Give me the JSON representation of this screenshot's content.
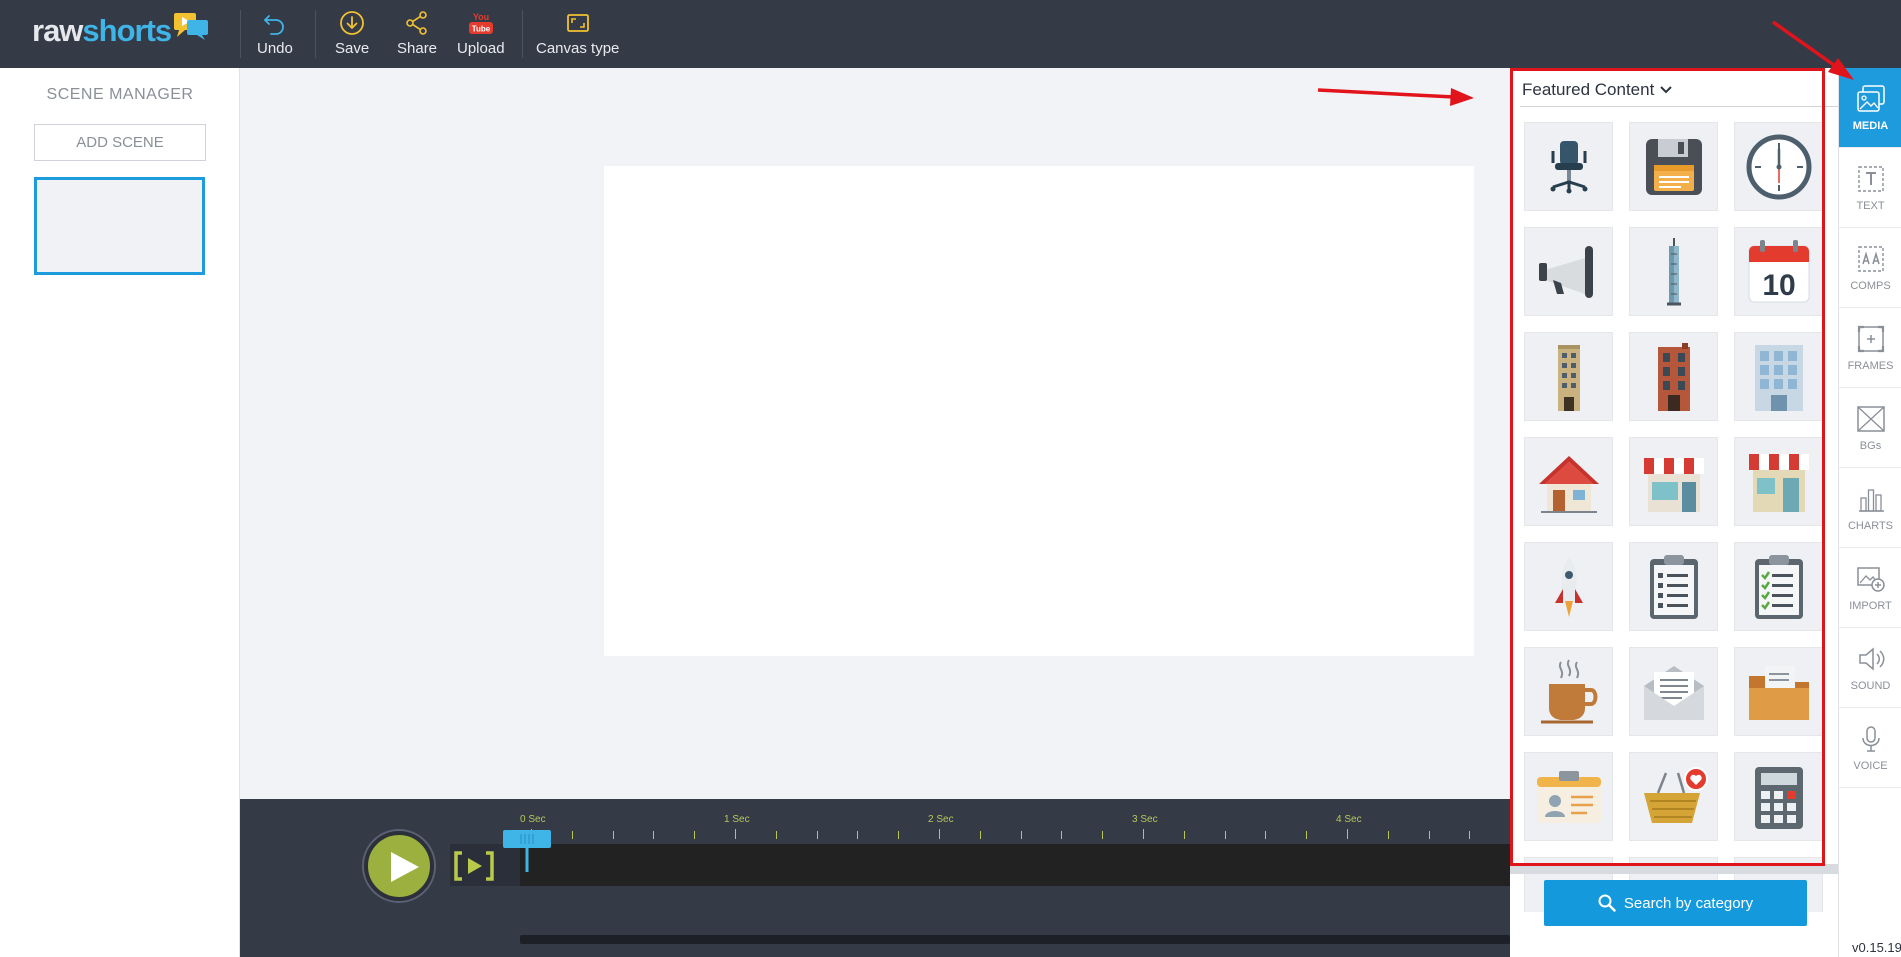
{
  "app": {
    "logo_part1": "raw",
    "logo_part2": "shorts"
  },
  "toolbar": {
    "undo": "Undo",
    "save": "Save",
    "share": "Share",
    "upload": "Upload",
    "youtube_badge_top": "You",
    "youtube_badge_bottom": "Tube",
    "canvas_type": "Canvas type"
  },
  "scene_manager": {
    "title": "SCENE MANAGER",
    "add_scene": "ADD SCENE"
  },
  "timeline": {
    "labels": [
      "0 Sec",
      "1 Sec",
      "2 Sec",
      "3 Sec",
      "4 Sec"
    ]
  },
  "media_panel": {
    "heading": "Featured Content",
    "search_button": "Search by category",
    "items": [
      {
        "icon": "office-chair-icon"
      },
      {
        "icon": "floppy-disk-icon"
      },
      {
        "icon": "clock-icon"
      },
      {
        "icon": "megaphone-icon"
      },
      {
        "icon": "tower-icon"
      },
      {
        "icon": "calendar-icon",
        "text": "10"
      },
      {
        "icon": "tall-building-icon"
      },
      {
        "icon": "brick-building-icon"
      },
      {
        "icon": "glass-building-icon"
      },
      {
        "icon": "house-icon"
      },
      {
        "icon": "shop-icon"
      },
      {
        "icon": "store-icon"
      },
      {
        "icon": "rocket-icon"
      },
      {
        "icon": "clipboard-list-icon"
      },
      {
        "icon": "clipboard-check-icon"
      },
      {
        "icon": "coffee-cup-icon"
      },
      {
        "icon": "envelope-icon"
      },
      {
        "icon": "folder-icon"
      },
      {
        "icon": "id-card-icon"
      },
      {
        "icon": "shopping-basket-icon"
      },
      {
        "icon": "calculator-icon"
      }
    ]
  },
  "rail": {
    "items": [
      {
        "label": "MEDIA",
        "icon": "media-icon",
        "active": true
      },
      {
        "label": "TEXT",
        "icon": "text-icon"
      },
      {
        "label": "COMPS",
        "icon": "comps-icon"
      },
      {
        "label": "FRAMES",
        "icon": "frames-icon"
      },
      {
        "label": "BGs",
        "icon": "backgrounds-icon"
      },
      {
        "label": "CHARTS",
        "icon": "charts-icon"
      },
      {
        "label": "IMPORT",
        "icon": "import-icon"
      },
      {
        "label": "SOUND",
        "icon": "sound-icon"
      },
      {
        "label": "VOICE",
        "icon": "voice-icon"
      }
    ]
  },
  "version": "v0.15.19",
  "colors": {
    "topbar": "#353a47",
    "accent": "#1e9bdc",
    "play": "#9bb03e",
    "annotation": "#e2141b"
  }
}
